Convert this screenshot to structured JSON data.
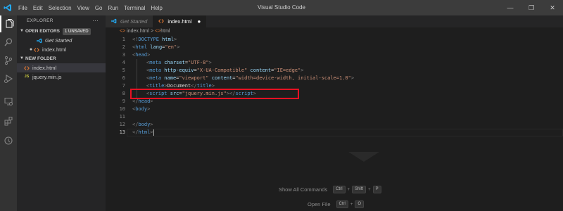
{
  "titlebar": {
    "menu": [
      "File",
      "Edit",
      "Selection",
      "View",
      "Go",
      "Run",
      "Terminal",
      "Help"
    ],
    "window_title": "Visual Studio Code",
    "minimize": "—",
    "maximize": "❐",
    "close": "✕"
  },
  "sidebar": {
    "header": "EXPLORER",
    "more": "···",
    "open_editors": {
      "label": "OPEN EDITORS",
      "badge": "1 UNSAVED"
    },
    "open_items": [
      {
        "label": "Get Started",
        "icon": "vscode-icon"
      },
      {
        "label": "index.html",
        "icon": "html-icon",
        "modified": "●"
      }
    ],
    "folder": "NEW FOLDER",
    "files": [
      {
        "label": "index.html",
        "icon": "html-icon"
      },
      {
        "label": "jquery.min.js",
        "icon": "js-icon",
        "icon_text": "JS"
      }
    ]
  },
  "tabs": [
    {
      "label": "Get Started",
      "active": false
    },
    {
      "label": "index.html",
      "active": true,
      "modified": "●"
    }
  ],
  "breadcrumb": {
    "file": "index.html",
    "sep": ">",
    "node": "html"
  },
  "code": {
    "lines": [
      {
        "n": "1",
        "tokens": [
          [
            "pun",
            "<!"
          ],
          [
            "tag",
            "DOCTYPE"
          ],
          [
            "txt",
            " "
          ],
          [
            "attr",
            "html"
          ],
          [
            "pun",
            ">"
          ]
        ],
        "indent": 0
      },
      {
        "n": "2",
        "tokens": [
          [
            "pun",
            "<"
          ],
          [
            "tag",
            "html"
          ],
          [
            "txt",
            " "
          ],
          [
            "attr",
            "lang"
          ],
          [
            "txt",
            "="
          ],
          [
            "str",
            "\"en\""
          ],
          [
            "pun",
            ">"
          ]
        ],
        "indent": 0
      },
      {
        "n": "3",
        "tokens": [
          [
            "pun",
            "<"
          ],
          [
            "tag",
            "head"
          ],
          [
            "pun",
            ">"
          ]
        ],
        "indent": 0
      },
      {
        "n": "4",
        "tokens": [
          [
            "pun",
            "<"
          ],
          [
            "tag",
            "meta"
          ],
          [
            "txt",
            " "
          ],
          [
            "attr",
            "charset"
          ],
          [
            "txt",
            "="
          ],
          [
            "str",
            "\"UTF-8\""
          ],
          [
            "pun",
            ">"
          ]
        ],
        "indent": 1
      },
      {
        "n": "5",
        "tokens": [
          [
            "pun",
            "<"
          ],
          [
            "tag",
            "meta"
          ],
          [
            "txt",
            " "
          ],
          [
            "attr",
            "http-equiv"
          ],
          [
            "txt",
            "="
          ],
          [
            "str",
            "\"X-UA-Compatible\""
          ],
          [
            "txt",
            " "
          ],
          [
            "attr",
            "content"
          ],
          [
            "txt",
            "="
          ],
          [
            "str",
            "\"IE=edge\""
          ],
          [
            "pun",
            ">"
          ]
        ],
        "indent": 1
      },
      {
        "n": "6",
        "tokens": [
          [
            "pun",
            "<"
          ],
          [
            "tag",
            "meta"
          ],
          [
            "txt",
            " "
          ],
          [
            "attr",
            "name"
          ],
          [
            "txt",
            "="
          ],
          [
            "str",
            "\"viewport\""
          ],
          [
            "txt",
            " "
          ],
          [
            "attr",
            "content"
          ],
          [
            "txt",
            "="
          ],
          [
            "str",
            "\"width=device-width, initial-scale=1.0\""
          ],
          [
            "pun",
            ">"
          ]
        ],
        "indent": 1
      },
      {
        "n": "7",
        "tokens": [
          [
            "pun",
            "<"
          ],
          [
            "tag",
            "title"
          ],
          [
            "pun",
            ">"
          ],
          [
            "txt",
            "Document"
          ],
          [
            "pun",
            "</"
          ],
          [
            "tag",
            "title"
          ],
          [
            "pun",
            ">"
          ]
        ],
        "indent": 1
      },
      {
        "n": "8",
        "tokens": [
          [
            "pun",
            "<"
          ],
          [
            "tag",
            "script"
          ],
          [
            "txt",
            " "
          ],
          [
            "attr",
            "src"
          ],
          [
            "txt",
            "="
          ],
          [
            "str",
            "\"jquery.min.js\""
          ],
          [
            "pun",
            "></"
          ],
          [
            "tag",
            "script"
          ],
          [
            "pun",
            ">"
          ]
        ],
        "indent": 1
      },
      {
        "n": "9",
        "tokens": [
          [
            "pun",
            "</"
          ],
          [
            "tag",
            "head"
          ],
          [
            "pun",
            ">"
          ]
        ],
        "indent": 0
      },
      {
        "n": "10",
        "tokens": [
          [
            "pun",
            "<"
          ],
          [
            "tag",
            "body"
          ],
          [
            "pun",
            ">"
          ]
        ],
        "indent": 0
      },
      {
        "n": "11",
        "tokens": [],
        "indent": 0
      },
      {
        "n": "12",
        "tokens": [
          [
            "pun",
            "</"
          ],
          [
            "tag",
            "body"
          ],
          [
            "pun",
            ">"
          ]
        ],
        "indent": 0
      },
      {
        "n": "13",
        "tokens": [
          [
            "pun",
            "</"
          ],
          [
            "tag",
            "html"
          ],
          [
            "pun",
            ">"
          ]
        ],
        "indent": 0,
        "current": true
      }
    ]
  },
  "hints": {
    "show_all": {
      "label": "Show All Commands",
      "keys": [
        "Ctrl",
        "Shift",
        "P"
      ]
    },
    "open_file": {
      "label": "Open File",
      "keys": [
        "Ctrl",
        "O"
      ]
    }
  },
  "colors": {
    "highlight_box": "#e81123",
    "vscode_blue": "#23a9f2",
    "html_icon": "#e37933",
    "js_icon": "#cbcb41"
  }
}
